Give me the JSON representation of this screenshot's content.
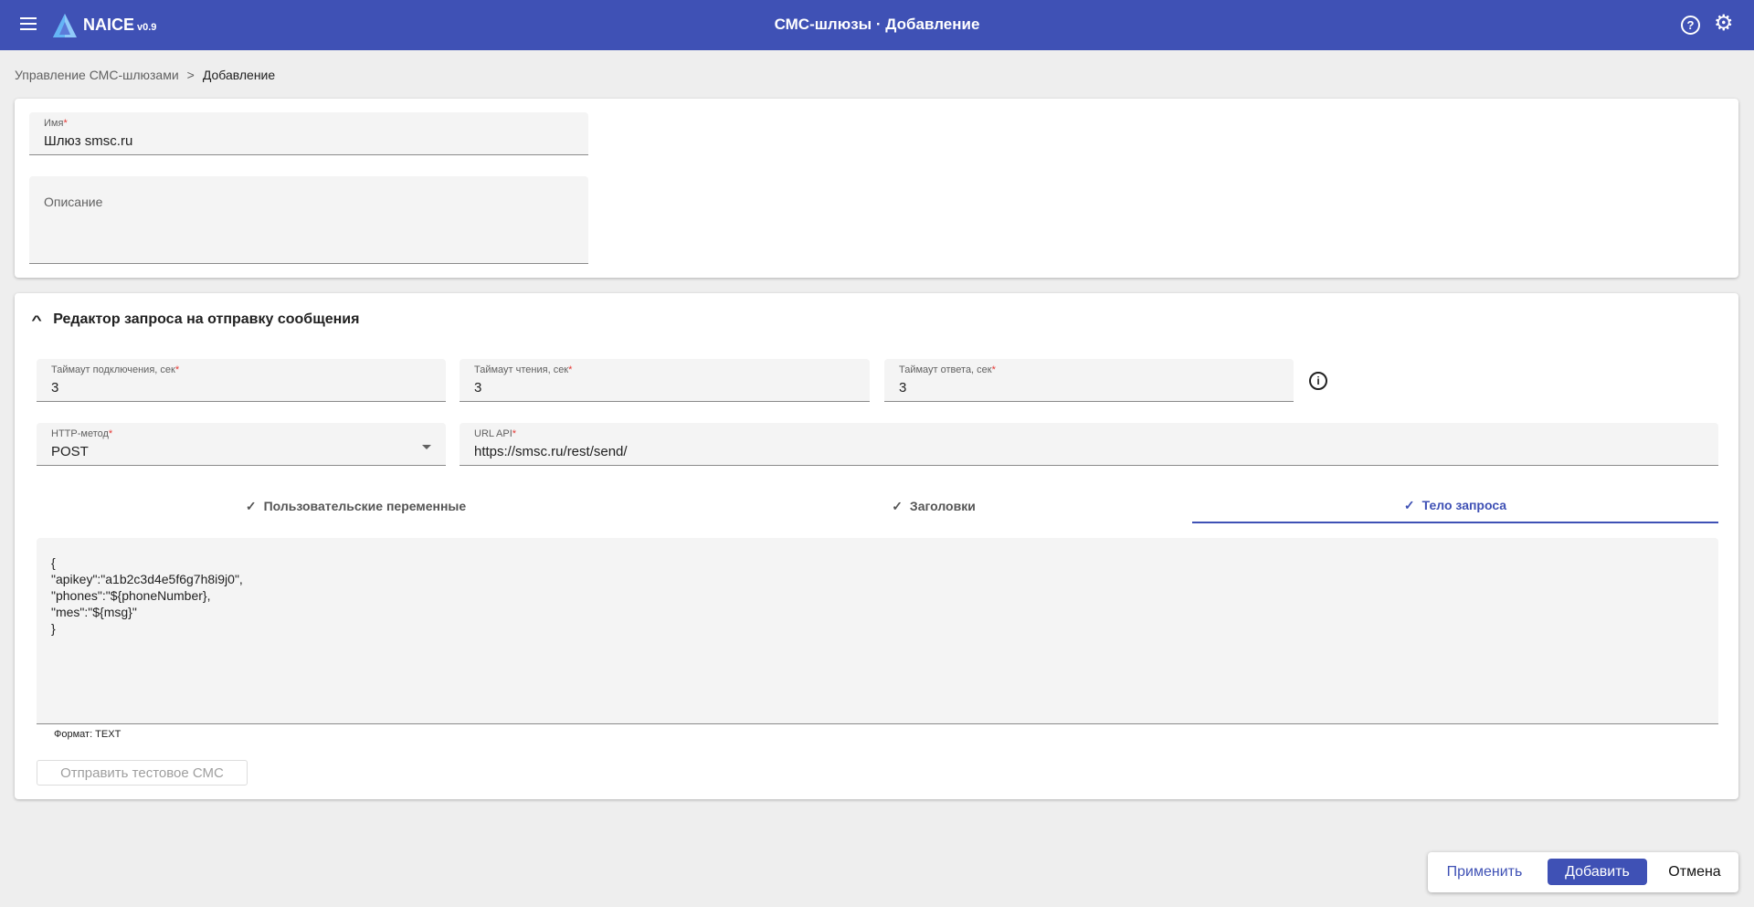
{
  "header": {
    "brand": "NAICE",
    "version": "v0.9",
    "title": "СМС-шлюзы · Добавление",
    "help_glyph": "?",
    "settings_glyph": "⚙"
  },
  "breadcrumb": {
    "parent": "Управление СМС-шлюзами",
    "separator": ">",
    "current": "Добавление"
  },
  "general": {
    "name": {
      "label": "Имя",
      "required": "*",
      "value": "Шлюз smsc.ru"
    },
    "description": {
      "placeholder": "Описание"
    }
  },
  "editor": {
    "title": "Редактор запроса на отправку сообщения",
    "connect_timeout": {
      "label": "Таймаут подключения, сек",
      "required": "*",
      "value": "3"
    },
    "read_timeout": {
      "label": "Таймаут чтения, сек",
      "required": "*",
      "value": "3"
    },
    "response_timeout": {
      "label": "Таймаут ответа, сек",
      "required": "*",
      "value": "3"
    },
    "http_method": {
      "label": "HTTP-метод",
      "required": "*",
      "value": "POST"
    },
    "url": {
      "label": "URL API",
      "required": "*",
      "value": "https://smsc.ru/rest/send/"
    },
    "tabs": [
      {
        "label": "Пользовательские переменные"
      },
      {
        "label": "Заголовки"
      },
      {
        "label": "Тело запроса"
      }
    ],
    "active_tab": 2,
    "body": "{\n\"apikey\":\"a1b2c3d4e5f6g7h8i9j0\",\n\"phones\":\"${phoneNumber},\n\"mes\":\"${msg}\"\n}",
    "format": "Формат: TEXT",
    "test_button": "Отправить тестовое СМС"
  },
  "actions": {
    "apply": "Применить",
    "add": "Добавить",
    "cancel": "Отмена"
  },
  "colors": {
    "primary": "#3f51b5",
    "required": "#e53935"
  }
}
